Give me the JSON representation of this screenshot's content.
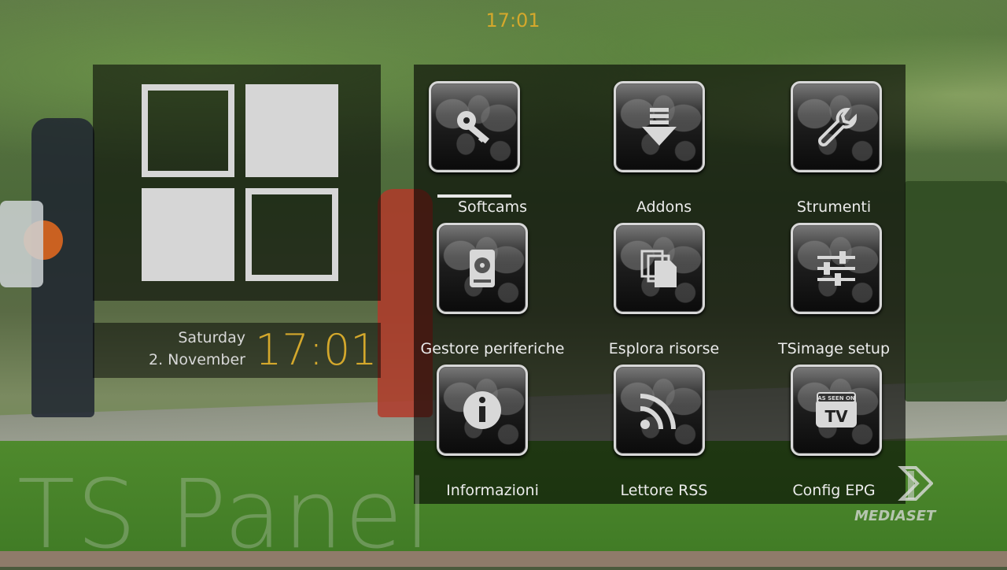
{
  "clock": {
    "top_time": "17:01",
    "big_time": "17:01",
    "weekday": "Saturday",
    "date": "2. November"
  },
  "colors": {
    "accent": "#d4a82c",
    "tile": "#d6d6d6",
    "text": "#ececec"
  },
  "menu": {
    "items": [
      {
        "label": "Softcams",
        "icon": "key-icon",
        "selected": true
      },
      {
        "label": "Addons",
        "icon": "download-arrow-icon",
        "selected": false
      },
      {
        "label": "Strumenti",
        "icon": "wrench-icon",
        "selected": false
      },
      {
        "label": "Gestore periferiche",
        "icon": "hard-drive-icon",
        "selected": false
      },
      {
        "label": "Esplora risorse",
        "icon": "files-icon",
        "selected": false
      },
      {
        "label": "TSimage setup",
        "icon": "sliders-icon",
        "selected": false
      },
      {
        "label": "Informazioni",
        "icon": "info-icon",
        "selected": false
      },
      {
        "label": "Lettore RSS",
        "icon": "rss-icon",
        "selected": false
      },
      {
        "label": "Config EPG",
        "icon": "tv-icon",
        "selected": false
      }
    ],
    "tv_icon_text": "AS SEEN ON TV"
  },
  "watermark": "TS Panel",
  "channel_logo": "MEDIASET"
}
